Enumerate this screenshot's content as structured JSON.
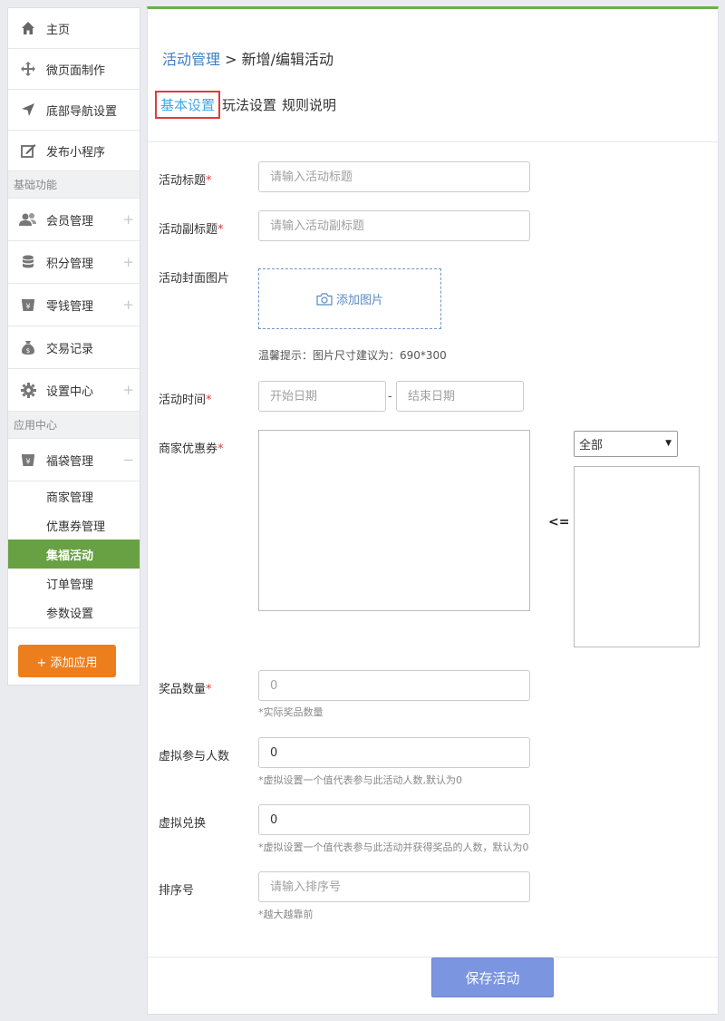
{
  "sidebar": {
    "top_items": [
      {
        "label": "主页",
        "icon": "home-icon"
      },
      {
        "label": "微页面制作",
        "icon": "move-icon"
      },
      {
        "label": "底部导航设置",
        "icon": "location-arrow-icon"
      },
      {
        "label": "发布小程序",
        "icon": "edit-icon"
      }
    ],
    "section_basic": "基础功能",
    "basic_items": [
      {
        "label": "会员管理",
        "icon": "users-icon",
        "expand": "+"
      },
      {
        "label": "积分管理",
        "icon": "database-icon",
        "expand": "+"
      },
      {
        "label": "零钱管理",
        "icon": "yen-cup-icon",
        "expand": "+"
      },
      {
        "label": "交易记录",
        "icon": "money-bag-icon"
      },
      {
        "label": "设置中心",
        "icon": "gear-icon",
        "expand": "+"
      }
    ],
    "section_app": "应用中心",
    "app_item": {
      "label": "福袋管理",
      "icon": "yen-cup-icon",
      "expand": "−"
    },
    "sub_items": [
      "商家管理",
      "优惠券管理",
      "集福活动",
      "订单管理",
      "参数设置"
    ],
    "active_sub": "集福活动",
    "add_app_label": "+ 添加应用"
  },
  "main": {
    "breadcrumb_link": "活动管理",
    "breadcrumb_sep": " > ",
    "breadcrumb_current": "新增/编辑活动",
    "tabs": [
      "基本设置",
      "玩法设置",
      "规则说明"
    ],
    "form": {
      "title_label": "活动标题",
      "title_placeholder": "请输入活动标题",
      "subtitle_label": "活动副标题",
      "subtitle_placeholder": "请输入活动副标题",
      "cover_label": "活动封面图片",
      "add_image": "添加图片",
      "image_hint": "温馨提示：图片尺寸建议为：690*300",
      "time_label": "活动时间",
      "start_placeholder": "开始日期",
      "end_placeholder": "结束日期",
      "date_sep": "-",
      "coupon_label": "商家优惠券",
      "coupon_arrow": "<=",
      "coupon_filter": "全部",
      "prize_label": "奖品数量",
      "prize_placeholder": "0",
      "prize_hint": "*实际奖品数量",
      "virtual_join_label": "虚拟参与人数",
      "virtual_join_value": "0",
      "virtual_join_hint": "*虚拟设置一个值代表参与此活动人数,默认为0",
      "virtual_redeem_label": "虚拟兑换",
      "virtual_redeem_value": "0",
      "virtual_redeem_hint": "*虚拟设置一个值代表参与此活动并获得奖品的人数，默认为0",
      "sort_label": "排序号",
      "sort_placeholder": "请输入排序号",
      "sort_hint": "*越大越靠前",
      "required_mark": "*"
    },
    "save_label": "保存活动"
  },
  "colors": {
    "accent_green": "#68a044",
    "link_blue": "#3f7cc0",
    "orange": "#ec7e1e",
    "save_blue": "#7b95e0",
    "required_red": "#e23b3b"
  }
}
